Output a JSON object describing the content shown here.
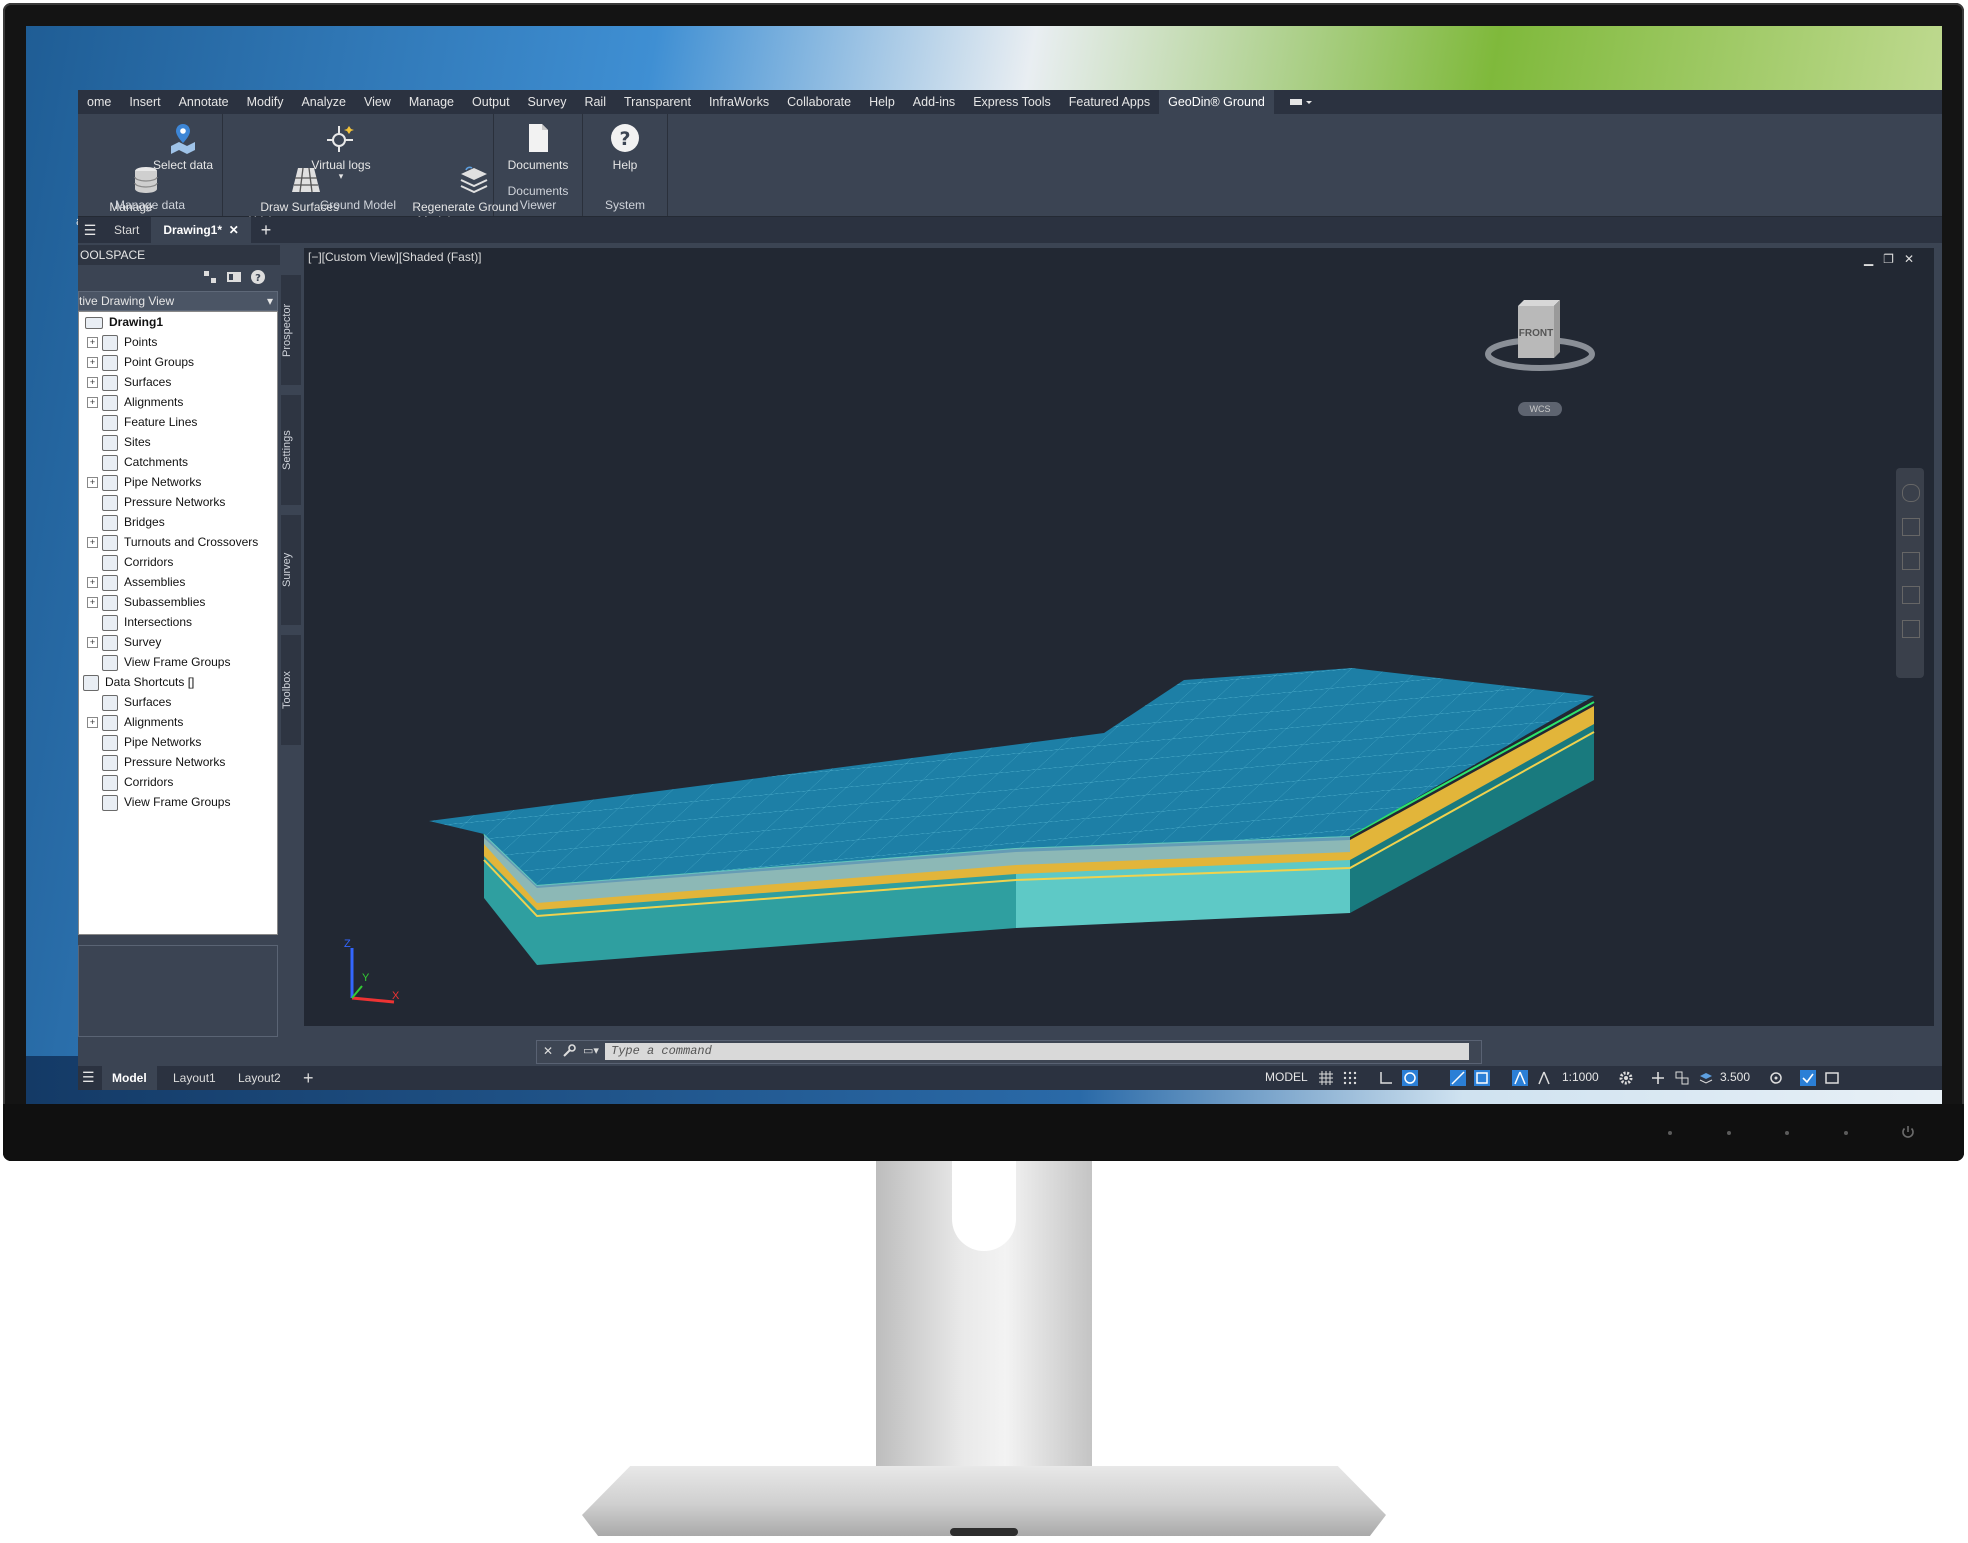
{
  "ribbon": {
    "tabs": [
      "ome",
      "Insert",
      "Annotate",
      "Modify",
      "Analyze",
      "View",
      "Manage",
      "Output",
      "Survey",
      "Rail",
      "Transparent",
      "InfraWorks",
      "Collaborate",
      "Help",
      "Add-ins",
      "Express Tools",
      "Featured Apps",
      "GeoDin® Ground"
    ],
    "active_tab": "GeoDin® Ground",
    "groups": {
      "manage_data": {
        "label": "Manage data",
        "btn_manage": "Manage\nata sources",
        "btn_select": "Select data"
      },
      "ground_model": {
        "label": "Ground Model",
        "btn_draw": "Draw Surfaces\nand Volumes",
        "btn_virtual": "Virtual logs",
        "btn_regen": "Regenerate Ground\nModel"
      },
      "documents_viewer": {
        "label": "Documents Viewer",
        "btn_documents": "Documents"
      },
      "system": {
        "label": "System",
        "btn_help": "Help"
      }
    }
  },
  "doc_tabs": {
    "start": "Start",
    "drawing": "Drawing1*"
  },
  "toolspace": {
    "title": "OOLSPACE",
    "view_select": "tive Drawing View",
    "side_tabs": [
      "Prospector",
      "Settings",
      "Survey",
      "Toolbox"
    ],
    "tree": {
      "root": "Drawing1",
      "items": [
        "Points",
        "Point Groups",
        "Surfaces",
        "Alignments",
        "Feature Lines",
        "Sites",
        "Catchments",
        "Pipe Networks",
        "Pressure Networks",
        "Bridges",
        "Turnouts and Crossovers",
        "Corridors",
        "Assemblies",
        "Subassemblies",
        "Intersections",
        "Survey",
        "View Frame Groups"
      ],
      "shortcuts_root": "Data Shortcuts []",
      "shortcut_items": [
        "Surfaces",
        "Alignments",
        "Pipe Networks",
        "Pressure Networks",
        "Corridors",
        "View Frame Groups"
      ]
    }
  },
  "viewport": {
    "label": "[−][Custom View][Shaded (Fast)]",
    "viewcube_face": "FRONT",
    "wcs": "WCS",
    "axis_x": "X",
    "axis_y": "Y",
    "axis_z": "Z"
  },
  "command": {
    "placeholder": "Type  a  command"
  },
  "statusbar": {
    "layouts": [
      "Model",
      "Layout1",
      "Layout2"
    ],
    "model_label": "MODEL",
    "scale": "1:1000",
    "value": "3.500"
  },
  "colors": {
    "accent": "#2b7fd6",
    "model_top": "#1f8fb0",
    "layer_yellow": "#e2b53a",
    "layer_teal": "#33a7a3"
  }
}
